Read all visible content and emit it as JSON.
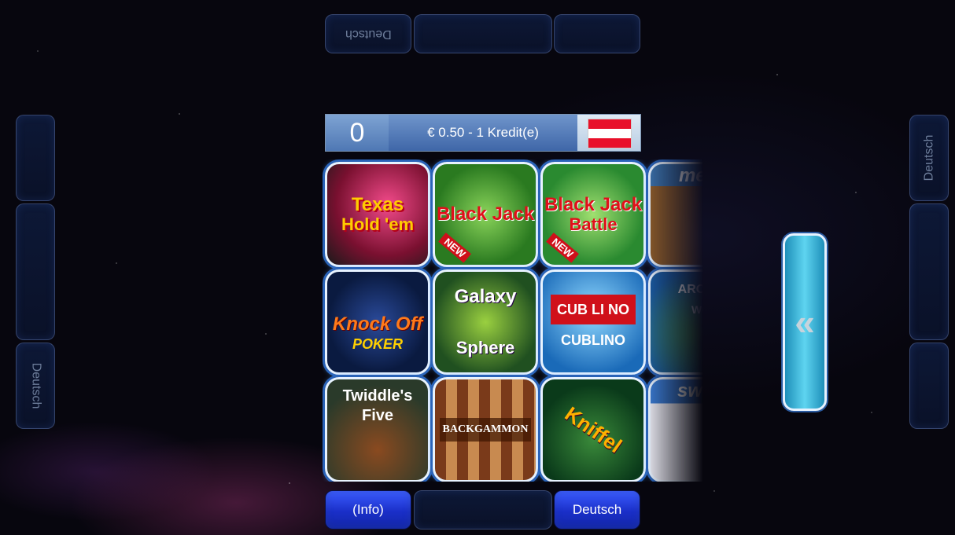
{
  "top_bar": {
    "lang_label": "Deutsch"
  },
  "left_bar": {
    "lang_label": "Deutsch"
  },
  "right_bar": {
    "lang_label": "Deutsch"
  },
  "credits": {
    "count": "0",
    "price_text": "€ 0.50 - 1 Kredit(e)",
    "flag": "austria-flag",
    "colors": {
      "red": "#e8102a",
      "white": "#ffffff"
    }
  },
  "games": [
    {
      "line1": "Texas",
      "line2": "Hold 'em",
      "badge": ""
    },
    {
      "line1": "Black Jack",
      "line2": "",
      "badge": "NEW"
    },
    {
      "line1": "Black Jack",
      "line2": "Battle",
      "badge": "NEW"
    },
    {
      "line1": "mem",
      "line2": "",
      "badge": ""
    },
    {
      "line1": "Knock Off",
      "line2": "POKER",
      "badge": ""
    },
    {
      "line1": "Galaxy",
      "line2": "Sphere",
      "badge": ""
    },
    {
      "line1": "CUB LI NO",
      "line2": "CUBLINO",
      "badge": ""
    },
    {
      "line1": "AROUN",
      "line2": "WO",
      "badge": ""
    },
    {
      "line1": "Twiddle's",
      "line2": "Five",
      "badge": ""
    },
    {
      "line1": "BACKGAMMON",
      "line2": "",
      "badge": ""
    },
    {
      "line1": "Kniffel",
      "line2": "",
      "badge": ""
    },
    {
      "line1": "swim",
      "line2": "",
      "badge": ""
    }
  ],
  "scroll": {
    "arrow": "«"
  },
  "bottom_bar": {
    "info_label": "(Info)",
    "lang_label": "Deutsch"
  }
}
